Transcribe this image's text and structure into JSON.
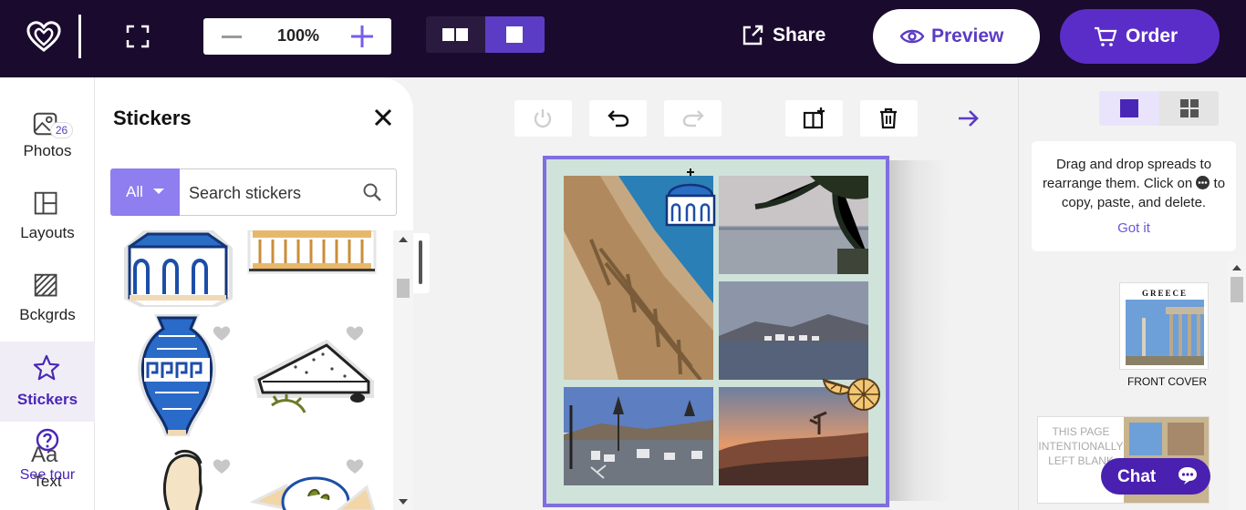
{
  "header": {
    "zoom_value": "100%",
    "share_label": "Share",
    "preview_label": "Preview",
    "order_label": "Order"
  },
  "leftnav": {
    "photos_label": "Photos",
    "photos_count": "26",
    "layouts_label": "Layouts",
    "backgrounds_label": "Bckgrds",
    "stickers_label": "Stickers",
    "text_label": "Text",
    "see_tour_label": "See tour"
  },
  "stickers_panel": {
    "title": "Stickers",
    "filter_value": "All",
    "search_placeholder": "Search stickers",
    "items": [
      "church-dome",
      "parthenon",
      "greek-vase",
      "feta-cheese",
      "statue-bust",
      "olive-plate"
    ]
  },
  "right_panel": {
    "tip_text_1": "Drag and drop spreads to rearrange them. Click on",
    "tip_text_2": "to copy, paste, and delete.",
    "tip_dismiss": "Got it",
    "cover_title": "GREECE",
    "cover_label": "FRONT COVER",
    "blank_page_text": "THIS PAGE INTENTIONALLY LEFT BLANK"
  },
  "chat": {
    "label": "Chat"
  },
  "colors": {
    "brand_dark": "#1a0a2e",
    "accent": "#5b2dc8",
    "page_border": "#7f6ee0"
  }
}
